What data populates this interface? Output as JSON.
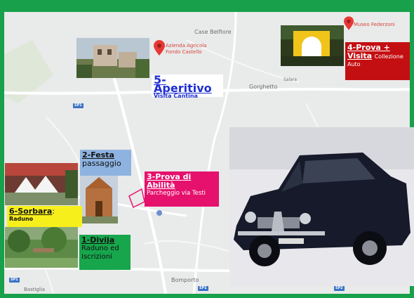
{
  "map": {
    "place_names": {
      "case_belfiore": "Case Belfiore",
      "gorghetto": "Gorghetto",
      "salara": "Salara",
      "bomporto": "Bomporto",
      "bastiglia": "Bastiglia"
    },
    "pins": {
      "azienda": "Azienda Agricola\nFondo Castello",
      "museo": "Museo Federzoni"
    },
    "highway_shields": [
      "SP1",
      "SP1",
      "SP1",
      "SP2"
    ]
  },
  "stops": {
    "aperitivo": {
      "number": "5-Aperitivo",
      "detail": "Visita Cantina",
      "bg": "#ffffff",
      "fg": "#1d2fd1"
    },
    "prova_visita": {
      "number": "4-Prova +",
      "number2": "Visita",
      "detail_inline": "Collezione",
      "detail": "Auto",
      "bg": "#c40f12",
      "fg": "#ffffff"
    },
    "festa": {
      "number": "2-Festa",
      "detail": "passaggio",
      "bg": "#8eb3e1",
      "fg": "#111111"
    },
    "prova_abilita": {
      "number": "3-Prova di",
      "number2": "Abilità",
      "detail": "Parcheggio via Testi",
      "bg": "#e5116d",
      "fg": "#ffffff"
    },
    "sorbara": {
      "number": "6-Sorbara",
      "suffix": ":",
      "detail": "Raduno",
      "bg": "#f7ef1b",
      "fg": "#111111"
    },
    "divija": {
      "number": "1-Divija",
      "detail": "Raduno ed",
      "detail2": "Iscrizioni",
      "bg": "#17a64c",
      "fg": "#111111"
    }
  },
  "colors": {
    "frame": "#18a04a",
    "map_bg": "#e9eaea",
    "pin": "#e53935",
    "car": "#161a2a"
  }
}
